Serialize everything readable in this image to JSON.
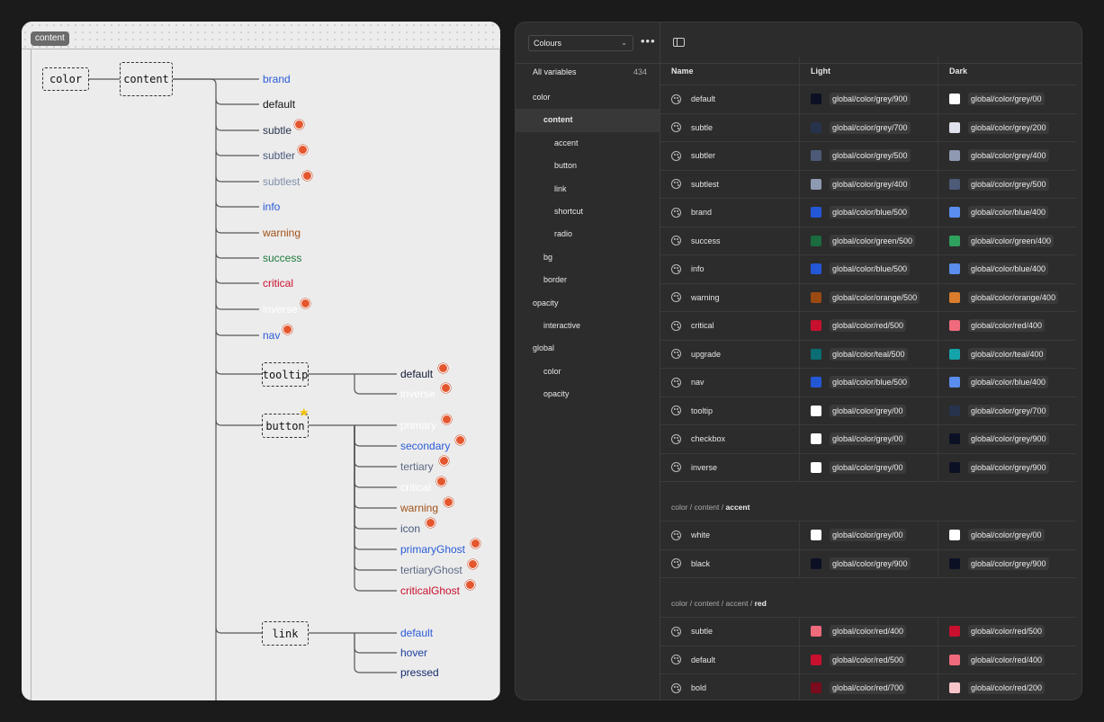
{
  "canvas": {
    "frame_label": "content",
    "nodes": {
      "color": "color",
      "content": "content",
      "tooltip": "tooltip",
      "button": "button",
      "link": "link"
    },
    "content_leaves": [
      {
        "label": "brand",
        "color": "#2a5bd7",
        "badge": false
      },
      {
        "label": "default",
        "color": "#111111",
        "badge": false
      },
      {
        "label": "subtle",
        "color": "#27334d",
        "badge": true
      },
      {
        "label": "subtler",
        "color": "#46577a",
        "badge": true
      },
      {
        "label": "subtlest",
        "color": "#7f8daa",
        "badge": true
      },
      {
        "label": "info",
        "color": "#2a5bd7",
        "badge": false
      },
      {
        "label": "warning",
        "color": "#a05018",
        "badge": false
      },
      {
        "label": "success",
        "color": "#1e7a3c",
        "badge": false
      },
      {
        "label": "critical",
        "color": "#c8102e",
        "badge": false
      },
      {
        "label": "inverse",
        "color": "#ffffff",
        "badge": true
      },
      {
        "label": "nav",
        "color": "#2a5bd7",
        "badge": true
      }
    ],
    "tooltip_leaves": [
      {
        "label": "default",
        "color": "#111a33",
        "badge": true
      },
      {
        "label": "inverse",
        "color": "#ffffff",
        "badge": true
      }
    ],
    "button_leaves": [
      {
        "label": "primary",
        "color": "#ffffff",
        "badge": true
      },
      {
        "label": "secondary",
        "color": "#2a5bd7",
        "badge": true
      },
      {
        "label": "tertiary",
        "color": "#5d6a85",
        "badge": true
      },
      {
        "label": "critical",
        "color": "#ffffff",
        "badge": true
      },
      {
        "label": "warning",
        "color": "#a05018",
        "badge": true
      },
      {
        "label": "icon",
        "color": "#46577a",
        "badge": true
      },
      {
        "label": "primaryGhost",
        "color": "#2a5bd7",
        "badge": true
      },
      {
        "label": "tertiaryGhost",
        "color": "#5d6a85",
        "badge": true
      },
      {
        "label": "criticalGhost",
        "color": "#c8102e",
        "badge": true
      }
    ],
    "link_leaves": [
      {
        "label": "default",
        "color": "#2a5bd7"
      },
      {
        "label": "hover",
        "color": "#1c3f9e"
      },
      {
        "label": "pressed",
        "color": "#152c6e"
      }
    ]
  },
  "panel": {
    "collection_select": "Colours",
    "more_icon": "•••",
    "sidebar": {
      "all_label": "All variables",
      "all_count": "434",
      "items": [
        {
          "label": "color",
          "level": 0,
          "selected": false
        },
        {
          "label": "content",
          "level": 1,
          "selected": true
        },
        {
          "label": "accent",
          "level": 2,
          "selected": false
        },
        {
          "label": "button",
          "level": 2,
          "selected": false
        },
        {
          "label": "link",
          "level": 2,
          "selected": false
        },
        {
          "label": "shortcut",
          "level": 2,
          "selected": false
        },
        {
          "label": "radio",
          "level": 2,
          "selected": false
        },
        {
          "label": "bg",
          "level": 1,
          "selected": false
        },
        {
          "label": "border",
          "level": 1,
          "selected": false
        },
        {
          "label": "opacity",
          "level": 0,
          "selected": false
        },
        {
          "label": "interactive",
          "level": 1,
          "selected": false
        },
        {
          "label": "global",
          "level": 0,
          "selected": false
        },
        {
          "label": "color",
          "level": 1,
          "selected": false
        },
        {
          "label": "opacity",
          "level": 1,
          "selected": false
        }
      ]
    },
    "table": {
      "headers": {
        "name": "Name",
        "light": "Light",
        "dark": "Dark"
      },
      "rows": [
        {
          "name": "default",
          "light": {
            "swatch": "#0b1024",
            "value": "global/color/grey/900"
          },
          "dark": {
            "swatch": "#ffffff",
            "value": "global/color/grey/00"
          }
        },
        {
          "name": "subtle",
          "light": {
            "swatch": "#27334d",
            "value": "global/color/grey/700"
          },
          "dark": {
            "swatch": "#dfe2ea",
            "value": "global/color/grey/200"
          }
        },
        {
          "name": "subtler",
          "light": {
            "swatch": "#4d5a78",
            "value": "global/color/grey/500"
          },
          "dark": {
            "swatch": "#8f99b1",
            "value": "global/color/grey/400"
          }
        },
        {
          "name": "subtlest",
          "light": {
            "swatch": "#8f99b1",
            "value": "global/color/grey/400"
          },
          "dark": {
            "swatch": "#4d5a78",
            "value": "global/color/grey/500"
          }
        },
        {
          "name": "brand",
          "light": {
            "swatch": "#2457d6",
            "value": "global/color/blue/500"
          },
          "dark": {
            "swatch": "#5b8def",
            "value": "global/color/blue/400"
          }
        },
        {
          "name": "success",
          "light": {
            "swatch": "#1b6b3f",
            "value": "global/color/green/500"
          },
          "dark": {
            "swatch": "#2fa05e",
            "value": "global/color/green/400"
          }
        },
        {
          "name": "info",
          "light": {
            "swatch": "#2457d6",
            "value": "global/color/blue/500"
          },
          "dark": {
            "swatch": "#5b8def",
            "value": "global/color/blue/400"
          }
        },
        {
          "name": "warning",
          "light": {
            "swatch": "#9b4a12",
            "value": "global/color/orange/500"
          },
          "dark": {
            "swatch": "#d97c2b",
            "value": "global/color/orange/400"
          }
        },
        {
          "name": "critical",
          "light": {
            "swatch": "#c8102e",
            "value": "global/color/red/500"
          },
          "dark": {
            "swatch": "#ef6a7b",
            "value": "global/color/red/400"
          }
        },
        {
          "name": "upgrade",
          "light": {
            "swatch": "#0b6e74",
            "value": "global/color/teal/500"
          },
          "dark": {
            "swatch": "#14a3a8",
            "value": "global/color/teal/400"
          }
        },
        {
          "name": "nav",
          "light": {
            "swatch": "#2457d6",
            "value": "global/color/blue/500"
          },
          "dark": {
            "swatch": "#5b8def",
            "value": "global/color/blue/400"
          }
        },
        {
          "name": "tooltip",
          "light": {
            "swatch": "#ffffff",
            "value": "global/color/grey/00"
          },
          "dark": {
            "swatch": "#27334d",
            "value": "global/color/grey/700"
          }
        },
        {
          "name": "checkbox",
          "light": {
            "swatch": "#ffffff",
            "value": "global/color/grey/00"
          },
          "dark": {
            "swatch": "#0b1024",
            "value": "global/color/grey/900"
          }
        },
        {
          "name": "inverse",
          "light": {
            "swatch": "#ffffff",
            "value": "global/color/grey/00"
          },
          "dark": {
            "swatch": "#0b1024",
            "value": "global/color/grey/900"
          }
        }
      ],
      "groups": [
        {
          "path_prefix": "color / content / ",
          "path_last": "accent",
          "rows": [
            {
              "name": "white",
              "light": {
                "swatch": "#ffffff",
                "value": "global/color/grey/00"
              },
              "dark": {
                "swatch": "#ffffff",
                "value": "global/color/grey/00"
              }
            },
            {
              "name": "black",
              "light": {
                "swatch": "#0b1024",
                "value": "global/color/grey/900"
              },
              "dark": {
                "swatch": "#0b1024",
                "value": "global/color/grey/900"
              }
            }
          ]
        },
        {
          "path_prefix": "color / content / accent / ",
          "path_last": "red",
          "rows": [
            {
              "name": "subtle",
              "light": {
                "swatch": "#ef6a7b",
                "value": "global/color/red/400"
              },
              "dark": {
                "swatch": "#c8102e",
                "value": "global/color/red/500"
              }
            },
            {
              "name": "default",
              "light": {
                "swatch": "#c8102e",
                "value": "global/color/red/500"
              },
              "dark": {
                "swatch": "#ef6a7b",
                "value": "global/color/red/400"
              }
            },
            {
              "name": "bold",
              "light": {
                "swatch": "#7a0c1d",
                "value": "global/color/red/700"
              },
              "dark": {
                "swatch": "#f7c4cb",
                "value": "global/color/red/200"
              }
            }
          ]
        }
      ]
    }
  }
}
